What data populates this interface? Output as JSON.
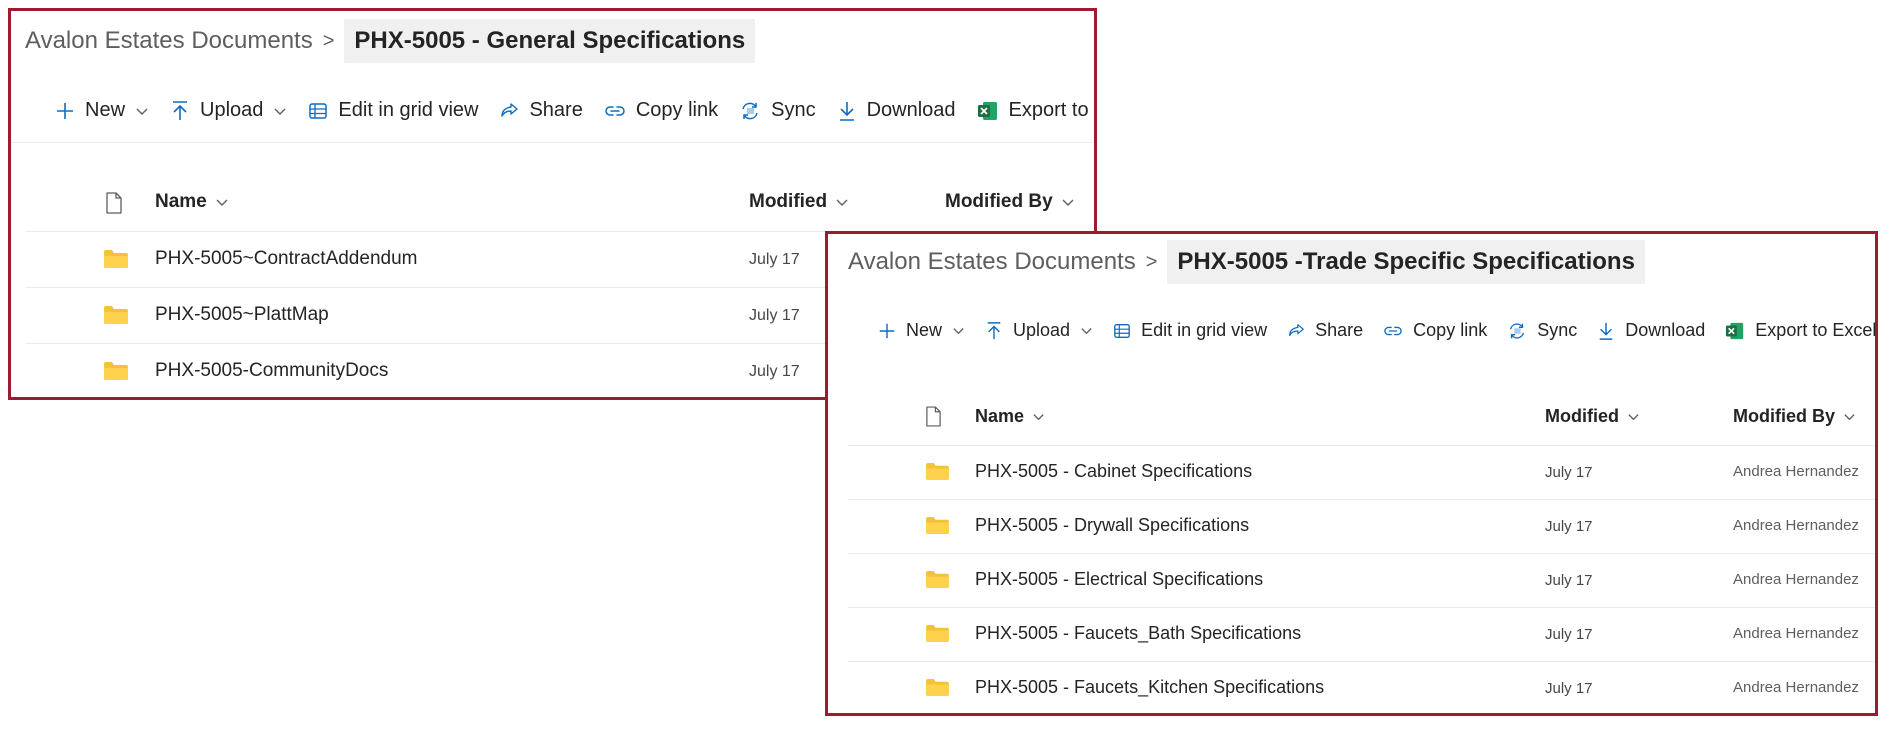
{
  "colors": {
    "frame_border": "#9b1b30",
    "folder": "#f3c13a",
    "excel": "#1d6f42"
  },
  "panel_general": {
    "breadcrumb": {
      "root": "Avalon Estates Documents",
      "separator": ">",
      "current": "PHX-5005 - General Specifications"
    },
    "toolbar": {
      "new": "New",
      "upload": "Upload",
      "grid": "Edit in grid view",
      "share": "Share",
      "copy_link": "Copy link",
      "sync": "Sync",
      "download": "Download",
      "export": "Export to Excel"
    },
    "columns": {
      "name": "Name",
      "modified": "Modified",
      "modified_by": "Modified By"
    },
    "rows": [
      {
        "name": "PHX-5005~ContractAddendum",
        "modified": "July 17"
      },
      {
        "name": "PHX-5005~PlattMap",
        "modified": "July 17"
      },
      {
        "name": "PHX-5005-CommunityDocs",
        "modified": "July 17"
      }
    ]
  },
  "panel_trade": {
    "breadcrumb": {
      "root": "Avalon Estates Documents",
      "separator": ">",
      "current": "PHX-5005 -Trade Specific Specifications"
    },
    "toolbar": {
      "new": "New",
      "upload": "Upload",
      "grid": "Edit in grid view",
      "share": "Share",
      "copy_link": "Copy link",
      "sync": "Sync",
      "download": "Download",
      "export": "Export to Excel"
    },
    "columns": {
      "name": "Name",
      "modified": "Modified",
      "modified_by": "Modified By"
    },
    "rows": [
      {
        "name": "PHX-5005 - Cabinet Specifications",
        "modified": "July 17",
        "modified_by": "Andrea Hernandez"
      },
      {
        "name": "PHX-5005 - Drywall Specifications",
        "modified": "July 17",
        "modified_by": "Andrea Hernandez"
      },
      {
        "name": "PHX-5005 - Electrical Specifications",
        "modified": "July 17",
        "modified_by": "Andrea Hernandez"
      },
      {
        "name": "PHX-5005 - Faucets_Bath Specifications",
        "modified": "July 17",
        "modified_by": "Andrea Hernandez"
      },
      {
        "name": "PHX-5005 - Faucets_Kitchen Specifications",
        "modified": "July 17",
        "modified_by": "Andrea Hernandez"
      }
    ]
  }
}
